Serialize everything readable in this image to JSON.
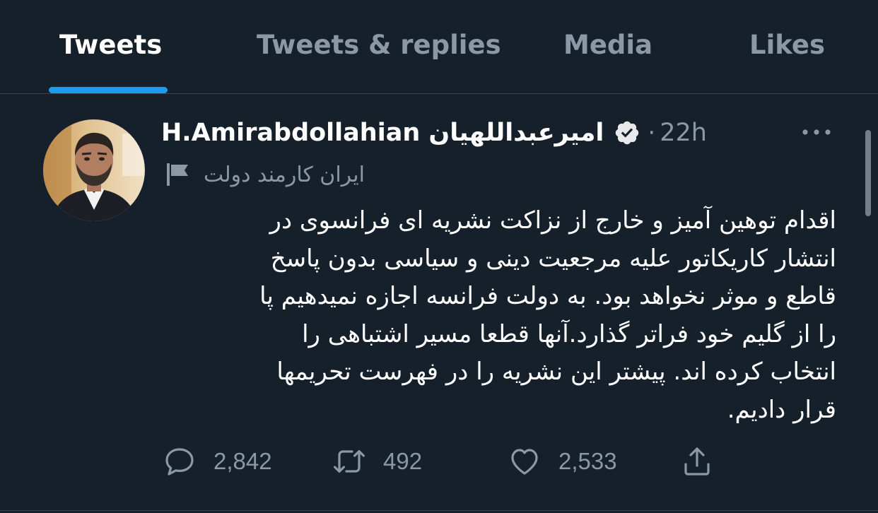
{
  "tabs": [
    {
      "label": "Tweets",
      "active": true
    },
    {
      "label": "Tweets & replies",
      "active": false
    },
    {
      "label": "Media",
      "active": false
    },
    {
      "label": "Likes",
      "active": false
    }
  ],
  "tweet": {
    "display_name": "H.Amirabdollahian امیرعبداللهیان",
    "verified": true,
    "separator": "·",
    "timestamp": "22h",
    "account_label": "ایران کارمند دولت",
    "text_lines": [
      "اقدام توهین آمیز و خارج از نزاکت نشریه ای فرانسوی در",
      "انتشار کاریکاتور علیه مرجعیت دینی و سیاسی بدون پاسخ",
      "قاطع و موثر نخواهد بود. به دولت فرانسه اجازه نمیدهیم پا",
      "را از گلیم خود فراتر گذارد.آنها قطعا مسیر اشتباهی را",
      "انتخاب کرده اند. پیشتر این نشریه را در فهرست تحریمها",
      "قرار دادیم."
    ],
    "actions": {
      "replies": "2,842",
      "retweets": "492",
      "likes": "2,533"
    }
  },
  "icons": {
    "more": "more-horizontal-icon",
    "verified": "verified-badge-icon",
    "label": "government-flag-icon",
    "reply": "reply-icon",
    "retweet": "retweet-icon",
    "like": "heart-icon",
    "share": "share-icon"
  },
  "colors": {
    "background": "#15202b",
    "accent": "#1d9bf0",
    "secondary_text": "#8b98a5",
    "divider": "#38444d"
  }
}
